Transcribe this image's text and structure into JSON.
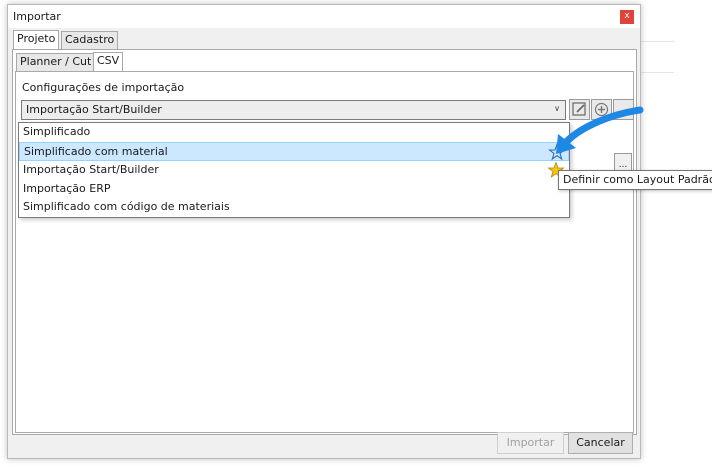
{
  "dialog": {
    "title": "Importar",
    "close_glyph": "x"
  },
  "tabs_top": [
    {
      "label": "Projeto",
      "active": true
    },
    {
      "label": "Cadastro",
      "active": false
    }
  ],
  "tabs_sub": [
    {
      "label": "Planner / Cut",
      "active": false
    },
    {
      "label": "CSV",
      "active": true
    }
  ],
  "config": {
    "label": "Configurações de importação",
    "selected": "Importação Start/Builder",
    "file_button": "..."
  },
  "dropdown": {
    "items": [
      {
        "label": "Simplificado",
        "highlighted": false
      },
      {
        "label": "Simplificado com material",
        "highlighted": true
      },
      {
        "label": "Importação Start/Builder",
        "highlighted": false
      },
      {
        "label": "Importação ERP",
        "highlighted": false
      },
      {
        "label": "Simplificado com código de materiais",
        "highlighted": false
      }
    ]
  },
  "tooltip": "Definir como Layout Padrão",
  "buttons": {
    "import": "Importar",
    "cancel": "Cancelar"
  },
  "colors": {
    "highlight": "#cce8ff",
    "close": "#e0433a",
    "arrow": "#1e88e5",
    "star_filled": "#f5c518"
  },
  "icons": [
    "edit-icon",
    "add-icon",
    "star-outline-icon",
    "star-filled-icon",
    "arrow-pointer-icon"
  ]
}
